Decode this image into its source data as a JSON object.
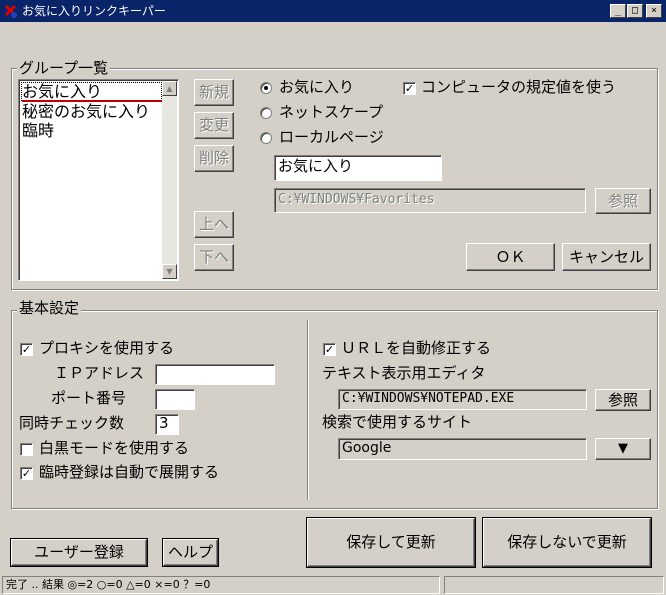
{
  "window": {
    "title": "お気に入りリンクキーパー",
    "controls": {
      "minimize": "_",
      "maximize": "□",
      "close": "×"
    }
  },
  "group_list": {
    "legend": "グループ一覧",
    "items": [
      "お気に入り",
      "秘密のお気に入り",
      "臨時"
    ],
    "selected_index": 0,
    "buttons": {
      "new": "新規",
      "change": "変更",
      "delete": "削除",
      "up": "上へ",
      "down": "下へ"
    }
  },
  "source": {
    "options": [
      "お気に入り",
      "ネットスケープ",
      "ローカルページ"
    ],
    "selected_index": 0,
    "use_default_label": "コンピュータの規定値を使う",
    "use_default_checked": true,
    "name_value": "お気に入り",
    "path_value": "C:¥WINDOWS¥Favorites",
    "browse_label": "参照"
  },
  "dialog_buttons": {
    "ok": "ＯＫ",
    "cancel": "キャンセル"
  },
  "basic": {
    "legend": "基本設定",
    "use_proxy_label": "プロキシを使用する",
    "use_proxy_checked": true,
    "ip_label": "ＩＰアドレス",
    "ip_value": "",
    "port_label": "ポート番号",
    "port_value": "",
    "concurrent_label": "同時チェック数",
    "concurrent_value": "3",
    "mono_label": "白黒モードを使用する",
    "mono_checked": false,
    "expand_label": "臨時登録は自動で展開する",
    "expand_checked": true,
    "url_fix_label": "ＵＲＬを自動修正する",
    "url_fix_checked": true,
    "editor_label": "テキスト表示用エディタ",
    "editor_value": "C:¥WINDOWS¥NOTEPAD.EXE",
    "editor_browse_label": "参照",
    "search_label": "検索で使用するサイト",
    "search_value": "Google",
    "dropdown_glyph": "▼"
  },
  "footer": {
    "register": "ユーザー登録",
    "help": "ヘルプ",
    "save_update": "保存して更新",
    "nosave_update": "保存しないで更新"
  },
  "status": {
    "text": "完了 .. 結果 ◎=2 ○=0 △=0 ×=0 ？=0"
  },
  "colors": {
    "face": "#d4d0c8",
    "titlebar": "#0a246a",
    "shadow": "#808080",
    "highlight": "#ffffff"
  },
  "icons": {
    "app": "app-icon",
    "dropdown": "chevron-down-icon"
  }
}
